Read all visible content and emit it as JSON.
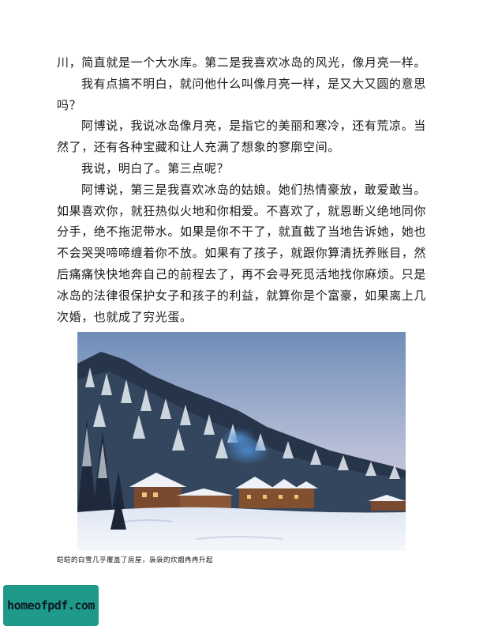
{
  "paragraphs": [
    {
      "text": "川，简直就是一个大水库。第二是我喜欢冰岛的风光，像月亮一样。",
      "indent": false
    },
    {
      "text": "我有点搞不明白，就问他什么叫像月亮一样，是又大又圆的意思吗？",
      "indent": true
    },
    {
      "text": "阿博说，我说冰岛像月亮，是指它的美丽和寒冷，还有荒凉。当然了，还有各种宝藏和让人充满了想象的寥廓空间。",
      "indent": true
    },
    {
      "text": "我说，明白了。第三点呢？",
      "indent": true
    },
    {
      "text": "阿博说，第三是我喜欢冰岛的姑娘。她们热情豪放，敢爱敢当。如果喜欢你，就狂热似火地和你相爱。不喜欢了，就恩断义绝地同你分手，绝不拖泥带水。如果是你不干了，就直截了当地告诉她，她也不会哭哭啼啼缠着你不放。如果有了孩子，就跟你算清抚养账目，然后痛痛快快地奔自己的前程去了，再不会寻死觅活地找你麻烦。只是冰岛的法律很保护女子和孩子的利益，就算你是个富豪，如果离上几次婚，也就成了穷光蛋。",
      "indent": true
    }
  ],
  "photo": {
    "scene": "snow-covered mountain forest with wooden lodges and chimney smoke"
  },
  "caption": "皑皑的白雪几乎覆盖了房屋，袅袅的炊烟冉冉升起",
  "watermark": "homeofpdf.com",
  "colors": {
    "watermark_bg": "#1f9a8a",
    "text": "#1a1a1a"
  }
}
